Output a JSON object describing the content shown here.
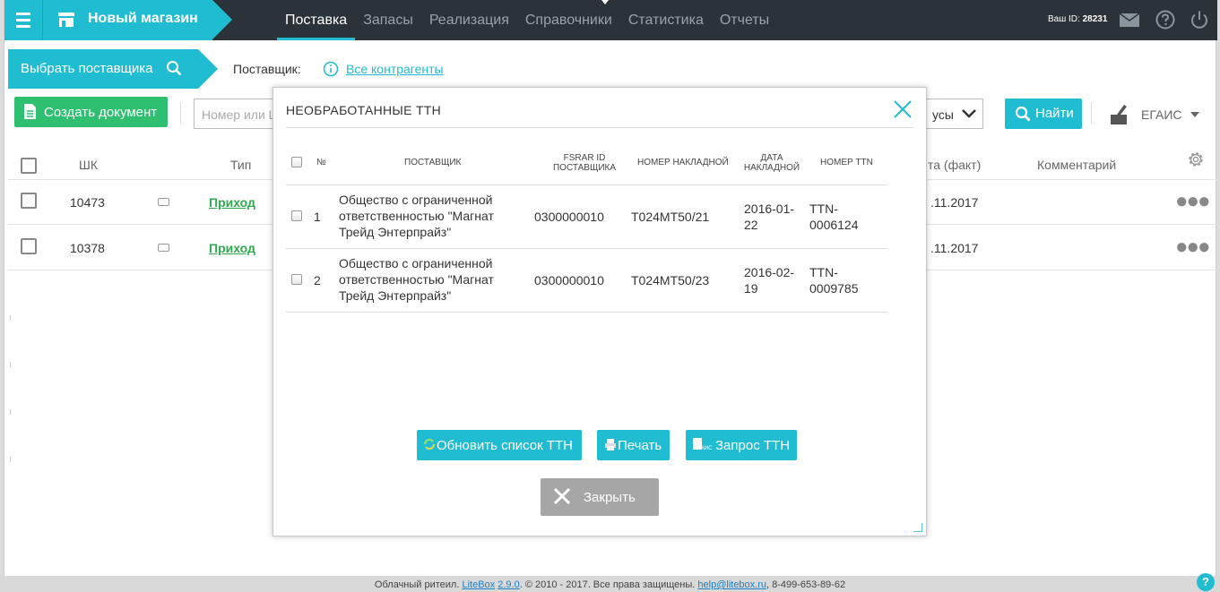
{
  "topbar": {
    "store_name": "Новый магазин",
    "nav": [
      "Поставка",
      "Запасы",
      "Реализация",
      "Справочники",
      "Статистика",
      "Отчеты"
    ],
    "user_id_label": "Ваш ID:",
    "user_id": "28231"
  },
  "supplier_bar": {
    "choose_label": "Выбрать поставщика",
    "supplier_label": "Поставщик:",
    "supplier_value": "Все контрагенты"
  },
  "toolbar": {
    "create_label": "Создать документ",
    "search_placeholder": "Номер или Ш",
    "status_value": "усы",
    "find_label": "Найти",
    "egais_label": "ЕГАИС"
  },
  "main_table": {
    "headers": {
      "barcode": "ШК",
      "type": "Тип",
      "date": "та (факт)",
      "comment": "Комментарий"
    },
    "rows": [
      {
        "id": "10473",
        "type": "Приход",
        "date": ".11.2017"
      },
      {
        "id": "10378",
        "type": "Приход",
        "date": ".11.2017"
      }
    ]
  },
  "modal": {
    "title": "НЕОБРАБОТАННЫЕ ТТН",
    "headers": {
      "num": "№",
      "supplier": "ПОСТАВЩИК",
      "fsrar_1": "FSRAR ID",
      "fsrar_2": "ПОСТАВЩИКА",
      "invoice_no": "НОМЕР НАКЛАДНОЙ",
      "invoice_date_1": "ДАТА",
      "invoice_date_2": "НАКЛАДНОЙ",
      "ttn_no": "НОМЕР TTN"
    },
    "rows": [
      {
        "num": "1",
        "supplier_1": "Общество с ограниченной",
        "supplier_2": "ответственностью \"Магнат",
        "supplier_3": "Трейд Энтерпрайз\"",
        "fsrar": "0300000010",
        "invoice": "Т024МТ50/21",
        "date_1": "2016-01-",
        "date_2": "22",
        "ttn_1": "TTN-",
        "ttn_2": "0006124"
      },
      {
        "num": "2",
        "supplier_1": "Общество с ограниченной",
        "supplier_2": "ответственностью \"Магнат",
        "supplier_3": "Трейд Энтерпрайз\"",
        "fsrar": "0300000010",
        "invoice": "Т024МТ50/23",
        "date_1": "2016-02-",
        "date_2": "19",
        "ttn_1": "TTN-",
        "ttn_2": "0009785"
      }
    ],
    "buttons": {
      "refresh": "Обновить список ТТН",
      "print": "Печать",
      "request": "Запрос ТТН",
      "close": "Закрыть"
    }
  },
  "footer": {
    "prefix": "Облачный ритеил.",
    "brand": "LiteBox",
    "version": "2.9.0",
    "copyright": ". © 2010 - 2017. Все права защищены.",
    "email": "help@litebox.ru",
    "phone": ", 8-499-653-89-62"
  },
  "colors": {
    "accent": "#1fbcd2",
    "green": "#2fbf71",
    "topbar": "#2b3238"
  }
}
